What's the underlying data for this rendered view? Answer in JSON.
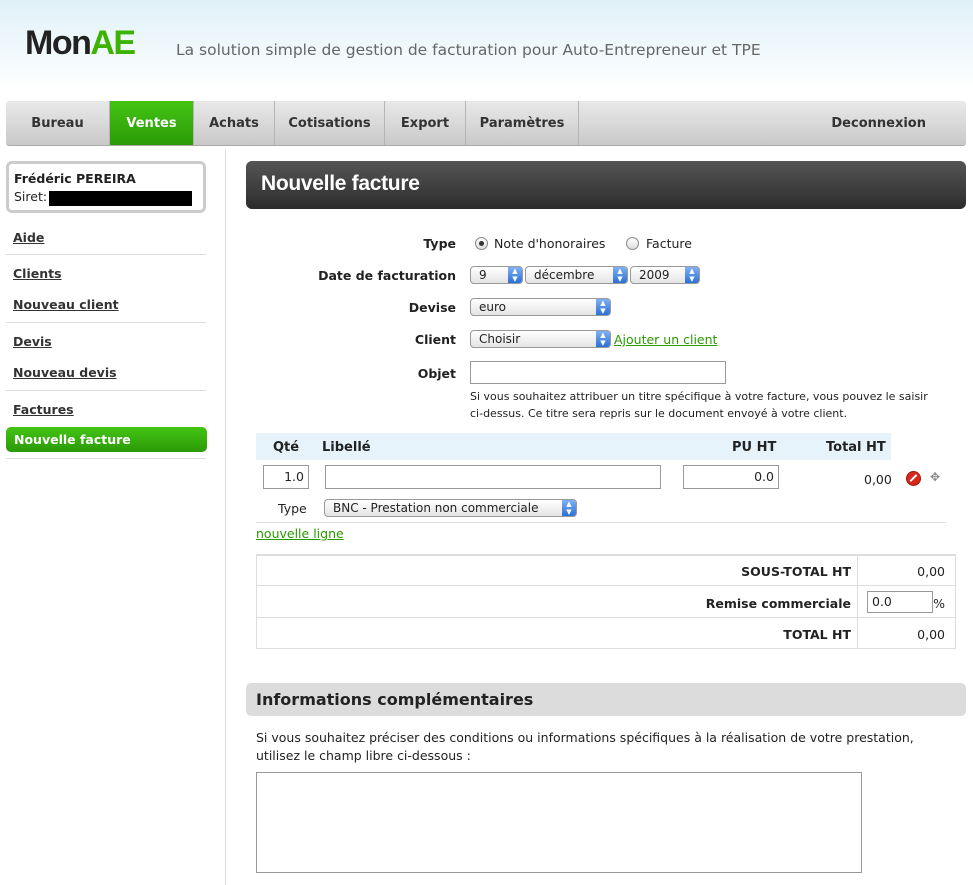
{
  "header": {
    "logo_part1": "Mon",
    "logo_part2": "AE",
    "tagline": "La solution simple de gestion de facturation pour Auto-Entrepreneur et TPE"
  },
  "nav": {
    "tabs": [
      {
        "label": "Bureau"
      },
      {
        "label": "Ventes",
        "active": true
      },
      {
        "label": "Achats"
      },
      {
        "label": "Cotisations"
      },
      {
        "label": "Export"
      },
      {
        "label": "Paramètres"
      }
    ],
    "logout": "Deconnexion"
  },
  "user": {
    "name": "Frédéric PEREIRA",
    "siret_label": "Siret:"
  },
  "sidebar": {
    "items": [
      "Aide",
      "Clients",
      "Nouveau client",
      "Devis",
      "Nouveau devis",
      "Factures",
      "Nouvelle facture"
    ]
  },
  "page": {
    "title": "Nouvelle facture"
  },
  "form": {
    "type_label": "Type",
    "type_option1": "Note d'honoraires",
    "type_option2": "Facture",
    "type_selected": "Note d'honoraires",
    "date_label": "Date de facturation",
    "day": "9",
    "month": "décembre",
    "year": "2009",
    "devise_label": "Devise",
    "devise": "euro",
    "client_label": "Client",
    "client": "Choisir",
    "add_client": "Ajouter un client",
    "objet_label": "Objet",
    "objet_value": "",
    "hint": "Si vous souhaitez attribuer un titre spécifique à votre facture, vous pouvez le saisir ci-dessus. Ce titre sera repris sur le document envoyé à votre client."
  },
  "lines": {
    "headers": {
      "qty": "Qté",
      "label": "Libellé",
      "pu": "PU HT",
      "total": "Total HT"
    },
    "row": {
      "qty": "1.0",
      "label": "",
      "pu": "0.0",
      "total": "0,00",
      "type_label": "Type",
      "type": "BNC - Prestation non commerciale"
    },
    "new_line": "nouvelle ligne"
  },
  "totals": {
    "subtotal_label": "SOUS-TOTAL HT",
    "subtotal": "0,00",
    "discount_label": "Remise commerciale",
    "discount": "0.0",
    "discount_unit": "%",
    "total_label": "TOTAL HT",
    "total": "0,00"
  },
  "info": {
    "title": "Informations complémentaires",
    "text": "Si vous souhaitez préciser des conditions ou informations spécifiques à la réalisation de votre prestation, utilisez le champ libre ci-dessous :"
  },
  "colors": {
    "accent_green": "#3cb300",
    "dark_bar": "#2c2c2c"
  },
  "icons": {
    "delete": "delete-icon",
    "move": "move-icon"
  }
}
